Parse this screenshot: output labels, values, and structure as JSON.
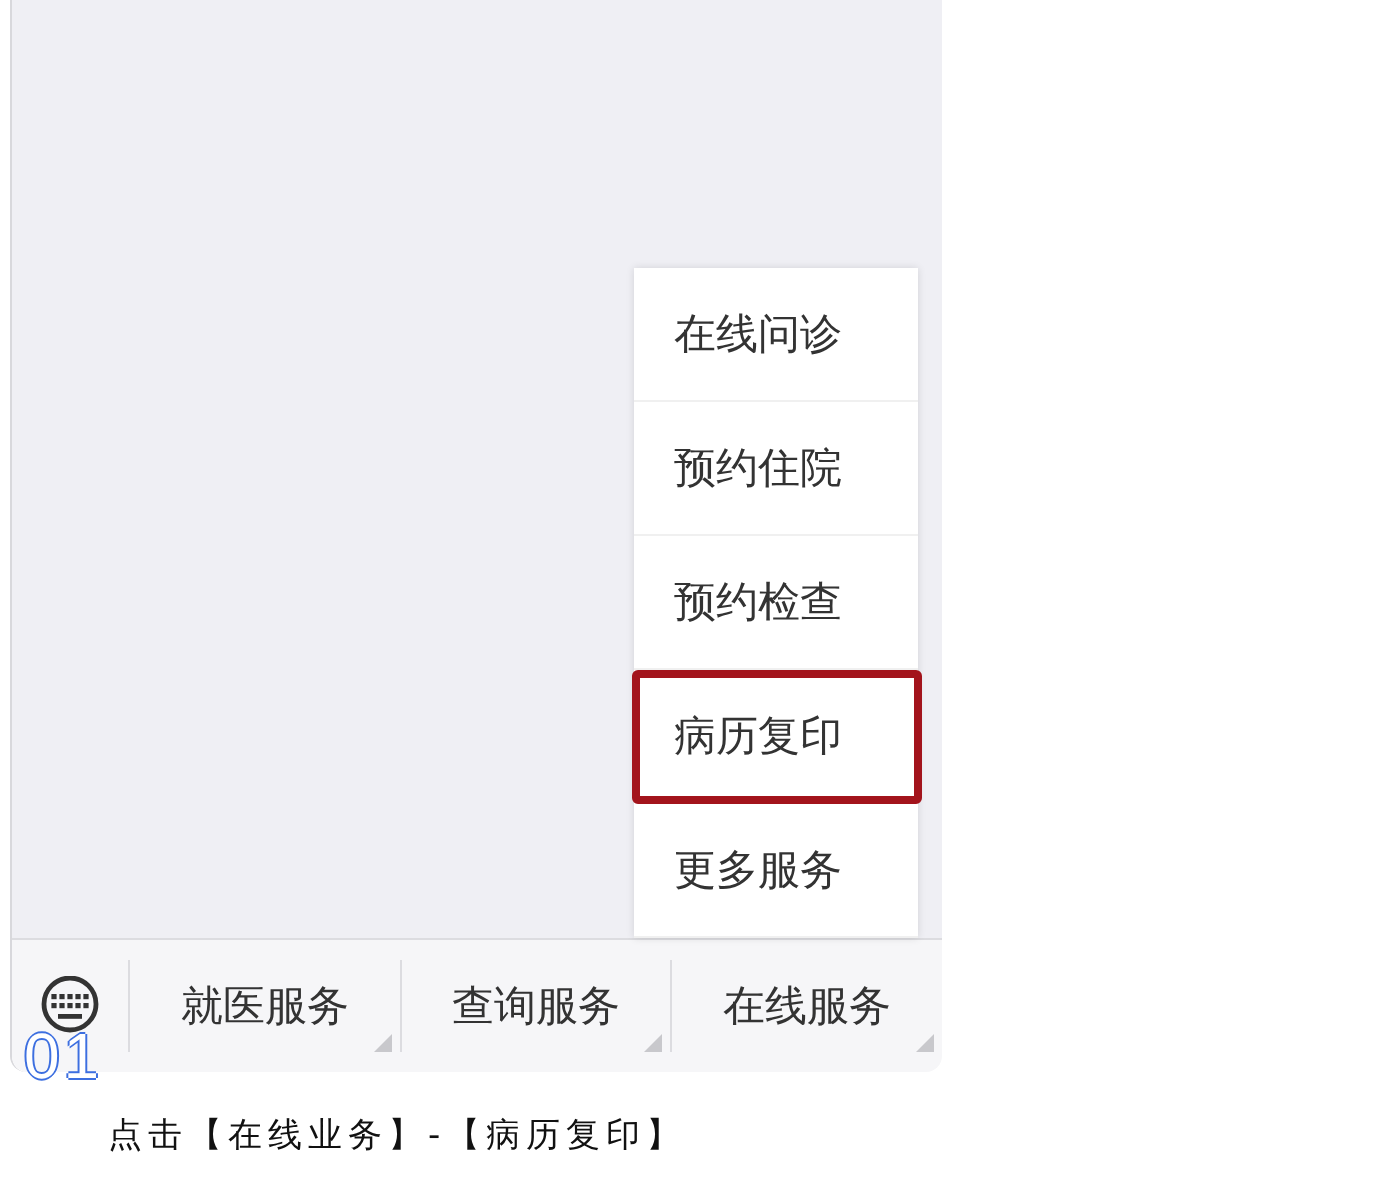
{
  "phone": {
    "popup_menu": {
      "items": [
        {
          "label": "在线问诊",
          "highlighted": false
        },
        {
          "label": "预约住院",
          "highlighted": false
        },
        {
          "label": "预约检查",
          "highlighted": false
        },
        {
          "label": "病历复印",
          "highlighted": true
        },
        {
          "label": "更多服务",
          "highlighted": false
        }
      ]
    },
    "menu_bar": {
      "items": [
        {
          "label": "就医服务"
        },
        {
          "label": "查询服务"
        },
        {
          "label": "在线服务"
        }
      ]
    }
  },
  "step_number": "01",
  "caption": "点击【在线业务】-【病历复印】"
}
